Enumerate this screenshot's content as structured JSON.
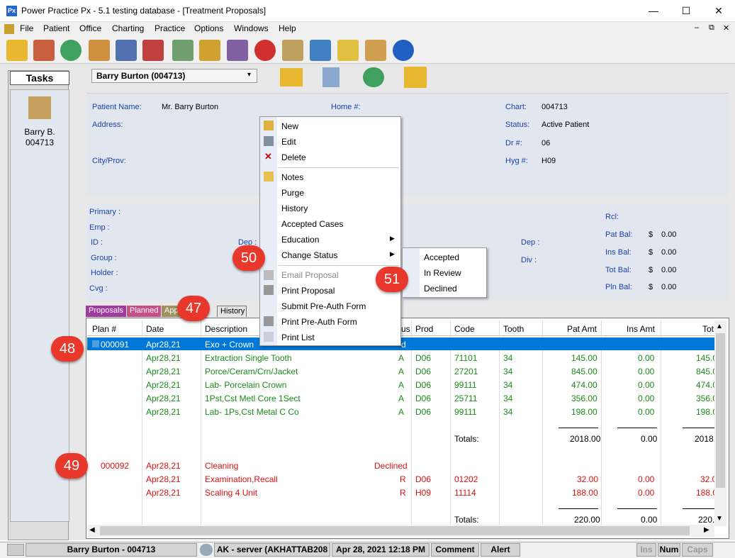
{
  "window": {
    "app_icon": "Px",
    "title": "Power Practice Px - 5.1 testing database - [Treatment Proposals]",
    "minimize": "—",
    "maximize": "☐",
    "close": "✕"
  },
  "menu": [
    "File",
    "Patient",
    "Office",
    "Charting",
    "Practice",
    "Options",
    "Windows",
    "Help"
  ],
  "tasks": {
    "title": "Tasks",
    "patient_short": "Barry B.",
    "patient_chart": "004713"
  },
  "patient": {
    "selector": "Barry Burton (004713)",
    "name_label": "Patient Name:",
    "name": "Mr. Barry Burton",
    "address_label": "Address:",
    "city_label": "City/Prov:",
    "home_label": "Home #:",
    "chart_label": "Chart:",
    "chart": "004713",
    "status_label": "Status:",
    "status": "Active Patient",
    "dr_label": "Dr #:",
    "dr": "06",
    "hyg_label": "Hyg #:",
    "hyg": "H09"
  },
  "insurance": {
    "primary": "Primary :",
    "emp": "Emp :",
    "id": "ID :",
    "group": "Group :",
    "holder": "Holder :",
    "cvg": "Cvg :",
    "dep1": "Dep :",
    "dep2": "Dep :",
    "div": "Div :",
    "rcl": "Rcl:",
    "pat_bal_label": "Pat Bal:",
    "ins_bal_label": "Ins Bal:",
    "tot_bal_label": "Tot Bal:",
    "pln_bal_label": "Pln Bal:",
    "currency": "$",
    "pat_bal": "0.00",
    "ins_bal": "0.00",
    "tot_bal": "0.00",
    "pln_bal": "0.00"
  },
  "tabs": [
    "Proposals",
    "Planned",
    "App",
    "History"
  ],
  "grid": {
    "headers": [
      "Plan #",
      "Date",
      "Description",
      "us",
      "Prod",
      "Code",
      "Tooth",
      "Pat Amt",
      "Ins Amt",
      "Tot"
    ],
    "plan1": {
      "plan": "000091",
      "date": "Apr28,21",
      "desc": "Exo + Crown",
      "status": "d",
      "rows": [
        {
          "date": "Apr28,21",
          "desc": "Extraction Single Tooth",
          "st": "A",
          "prod": "D06",
          "code": "71101",
          "tooth": "34",
          "pat": "145.00",
          "ins": "0.00",
          "tot": "145.0"
        },
        {
          "date": "Apr28,21",
          "desc": "Porce/Ceram/Crn/Jacket",
          "st": "A",
          "prod": "D06",
          "code": "27201",
          "tooth": "34",
          "pat": "845.00",
          "ins": "0.00",
          "tot": "845.0"
        },
        {
          "date": "Apr28,21",
          "desc": "Lab- Porcelain Crown",
          "st": "A",
          "prod": "D06",
          "code": "99111",
          "tooth": "34",
          "pat": "474.00",
          "ins": "0.00",
          "tot": "474.0"
        },
        {
          "date": "Apr28,21",
          "desc": "1Pst,Cst Metl Core 1Sect",
          "st": "A",
          "prod": "D06",
          "code": "25711",
          "tooth": "34",
          "pat": "356.00",
          "ins": "0.00",
          "tot": "356.0"
        },
        {
          "date": "Apr28,21",
          "desc": "Lab- 1Ps,Cst Metal C Co",
          "st": "A",
          "prod": "D06",
          "code": "99111",
          "tooth": "34",
          "pat": "198.00",
          "ins": "0.00",
          "tot": "198.0"
        }
      ],
      "totals_label": "Totals:",
      "pat_total": "2018.00",
      "ins_total": "0.00",
      "tot_total": "2018."
    },
    "plan2": {
      "plan": "000092",
      "date": "Apr28,21",
      "desc": "Cleaning",
      "status": "Declined",
      "rows": [
        {
          "date": "Apr28,21",
          "desc": "Examination,Recall",
          "st": "R",
          "prod": "D06",
          "code": "01202",
          "tooth": "",
          "pat": "32.00",
          "ins": "0.00",
          "tot": "32.0"
        },
        {
          "date": "Apr28,21",
          "desc": "Scaling 4 Unit",
          "st": "R",
          "prod": "H09",
          "code": "11114",
          "tooth": "",
          "pat": "188.00",
          "ins": "0.00",
          "tot": "188.0"
        }
      ],
      "totals_label": "Totals:",
      "pat_total": "220.00",
      "ins_total": "0.00",
      "tot_total": "220."
    }
  },
  "context_menu": [
    "New",
    "Edit",
    "Delete",
    "Notes",
    "Purge",
    "History",
    "Accepted Cases",
    "Education",
    "Change Status",
    "Email Proposal",
    "Print Proposal",
    "Submit Pre-Auth Form",
    "Print Pre-Auth Form",
    "Print List"
  ],
  "submenu": [
    "Accepted",
    "In Review",
    "Declined"
  ],
  "callouts": [
    "47",
    "48",
    "49",
    "50",
    "51"
  ],
  "status_bar": {
    "patient": "Barry Burton - 004713",
    "server": "AK - server (AKHATTAB208",
    "datetime": "Apr 28, 2021 12:18 PM",
    "comment": "Comment",
    "alert": "Alert",
    "ins": "Ins",
    "num": "Num",
    "caps": "Caps"
  },
  "colors": {
    "selection": "#0078d7",
    "accepted_text": "#1a8a1a",
    "declined_text": "#dd1111",
    "callout": "#e8372b"
  }
}
